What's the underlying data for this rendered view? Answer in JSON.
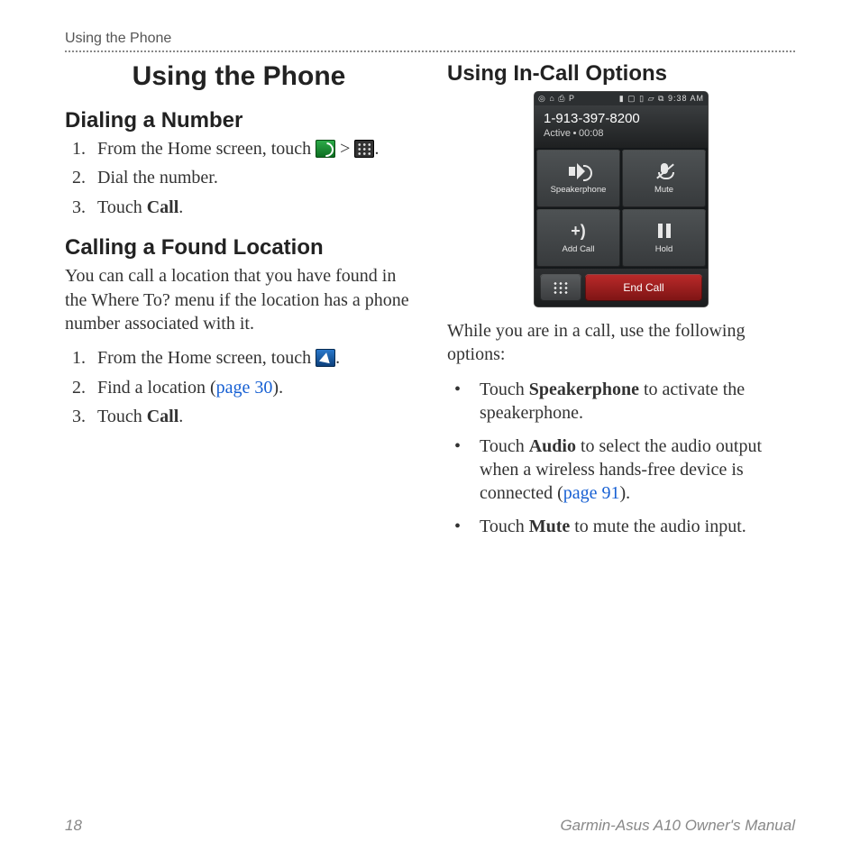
{
  "header": {
    "running": "Using the Phone"
  },
  "title": "Using the Phone",
  "sec_dial": {
    "heading": "Dialing a Number",
    "step1_a": "From the Home screen, touch ",
    "step1_b": " > ",
    "step1_c": ".",
    "step2": "Dial the number.",
    "step3_a": "Touch ",
    "step3_b": "Call",
    "step3_c": "."
  },
  "sec_found": {
    "heading": "Calling a Found Location",
    "body": "You can call a location that you have found in the Where To? menu if the location has a phone number associated with it.",
    "step1_a": "From the Home screen, touch ",
    "step1_b": ".",
    "step2_a": "Find a location (",
    "step2_link": "page 30",
    "step2_b": ").",
    "step3_a": "Touch ",
    "step3_b": "Call",
    "step3_c": "."
  },
  "sec_incall": {
    "heading": "Using In-Call Options",
    "body": "While you are in a call, use the following options:",
    "b1_a": "Touch ",
    "b1_b": "Speakerphone",
    "b1_c": " to activate the speakerphone.",
    "b2_a": "Touch ",
    "b2_b": "Audio",
    "b2_c": " to select the audio output when a wireless hands-free device is connected (",
    "b2_link": "page 91",
    "b2_d": ").",
    "b3_a": "Touch ",
    "b3_b": "Mute",
    "b3_c": " to mute the audio input."
  },
  "phone": {
    "status_left": "◎ ⌂ ⎙ P",
    "status_right": "▮ ▢ ▯ ▱ ⧉ 9:38 AM",
    "number": "1-913-397-8200",
    "sub_a": "Active",
    "sub_b": "00:08",
    "btn_spk": "Speakerphone",
    "btn_mute": "Mute",
    "btn_add": "Add Call",
    "btn_hold": "Hold",
    "end": "End Call"
  },
  "footer": {
    "page": "18",
    "title": "Garmin-Asus A10 Owner's Manual"
  }
}
